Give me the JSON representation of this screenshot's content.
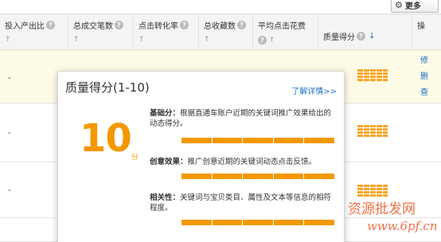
{
  "toolbar": {
    "more_label": "更多"
  },
  "columns": [
    {
      "label": "投入产出比",
      "sort": "↑"
    },
    {
      "label": "总成交笔数",
      "sort": "↑"
    },
    {
      "label": "点击转化率",
      "sort": "↑"
    },
    {
      "label": "总收藏数",
      "sort": "↑"
    },
    {
      "label": "平均点击花费",
      "sort": "↑"
    },
    {
      "label": "质量得分",
      "sort": "↓"
    },
    {
      "label": "操",
      "sort": ""
    }
  ],
  "rows": [
    {
      "roi": "-",
      "links": [
        "修",
        "删",
        "查"
      ]
    },
    {
      "roi": "-",
      "links": []
    },
    {
      "roi": "-",
      "links": []
    }
  ],
  "popup": {
    "title": "质量得分(1-10)",
    "details_link": "了解详情>>",
    "score": "10",
    "score_unit": "分",
    "items": [
      {
        "name": "基础分：",
        "desc": "根据直通车账户近期的关键词推广效果给出的动态得分。"
      },
      {
        "name": "创意效果：",
        "desc": "推广创意近期的关键词动态点击反馈。"
      },
      {
        "name": "相关性：",
        "desc": "关键词与宝贝类目、属性及文本等信息的相符程度。"
      }
    ]
  },
  "watermark": {
    "line1": "资源批发网",
    "line2": "www.6pf.cn"
  },
  "colors": {
    "accent": "#f39800",
    "link": "#1a6fc9"
  }
}
